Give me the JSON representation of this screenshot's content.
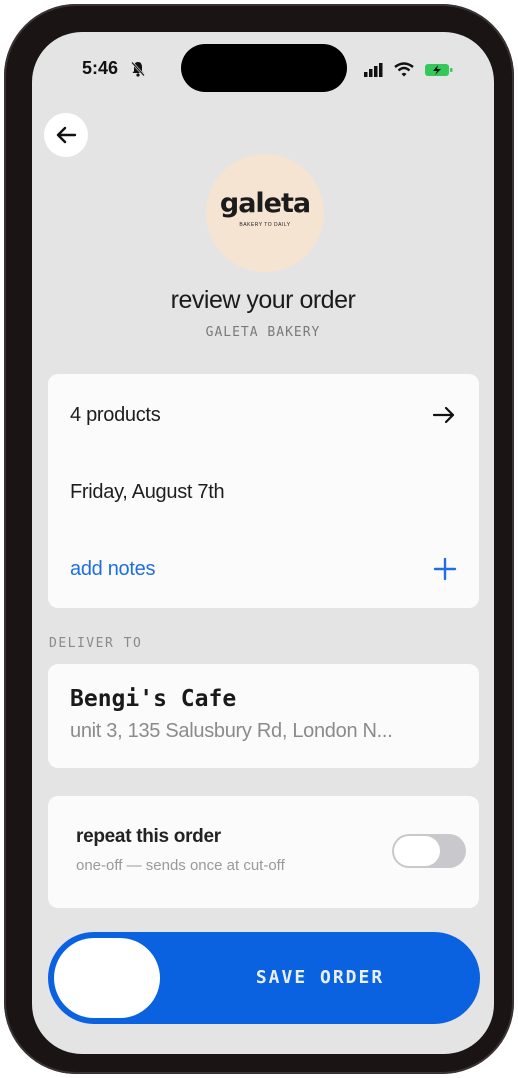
{
  "status_bar": {
    "time": "5:46",
    "icons": [
      "silent-bell-icon",
      "cellular-signal-icon",
      "wifi-icon",
      "battery-charging-icon"
    ]
  },
  "nav": {
    "back_icon": "arrow-left-icon"
  },
  "vendor": {
    "logo_text": "galeta",
    "logo_tagline": "BAKERY TO DAILY",
    "logo_bg": "#f6e4d2"
  },
  "header": {
    "title": "review your order",
    "subtitle": "GALETA BAKERY"
  },
  "order_summary": {
    "products_label": "4 products",
    "products_icon": "arrow-right-icon",
    "date_label": "Friday, August 7th",
    "notes_label": "add notes",
    "notes_icon": "plus-icon"
  },
  "delivery": {
    "section_label": "DELIVER TO",
    "name": "Bengi's Cafe",
    "address": "unit 3, 135 Salusbury Rd, London N..."
  },
  "repeat": {
    "title": "repeat this order",
    "subtitle": "one-off — sends once at cut-off",
    "enabled": false
  },
  "save_button": {
    "label": "SAVE ORDER"
  },
  "colors": {
    "accent": "#1f6fe0",
    "primary_button": "#0a62e0",
    "background": "#e4e4e4",
    "card": "#fbfbfb",
    "battery": "#35c759"
  }
}
